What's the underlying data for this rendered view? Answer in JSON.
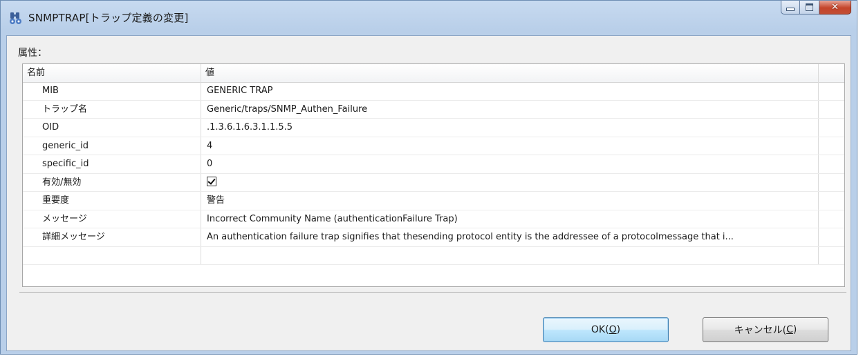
{
  "window": {
    "title": "SNMPTRAP[トラップ定義の変更]",
    "app_icon": "snmp-trap-icon",
    "caption_buttons": [
      "minimize-icon",
      "maximize-icon",
      "close-icon"
    ]
  },
  "attributes_label": "属性：",
  "table": {
    "headers": {
      "name": "名前",
      "value": "値"
    },
    "rows": [
      {
        "name": "MIB",
        "value": "GENERIC TRAP"
      },
      {
        "name": "トラップ名",
        "value": "Generic/traps/SNMP_Authen_Failure"
      },
      {
        "name": "OID",
        "value": ".1.3.6.1.6.3.1.1.5.5"
      },
      {
        "name": "generic_id",
        "value": "4"
      },
      {
        "name": "specific_id",
        "value": "0"
      },
      {
        "name": "有効/無効",
        "value": "",
        "checked": true
      },
      {
        "name": "重要度",
        "value": "警告"
      },
      {
        "name": "メッセージ",
        "value": "Incorrect Community Name (authenticationFailure Trap)"
      },
      {
        "name": "詳細メッセージ",
        "value": "An authentication failure trap signifies that thesending protocol entity is the addressee of a protocolmessage that i..."
      }
    ]
  },
  "buttons": {
    "ok": {
      "label": "OK(",
      "mnemonic": "O",
      "suffix": ")"
    },
    "cancel": {
      "label": "キャンセル(",
      "mnemonic": "C",
      "suffix": ")"
    }
  },
  "colors": {
    "frame": "#b9cfe9",
    "client_bg": "#f0f0f0",
    "default_button": "#3c7fb1",
    "close_button": "#c4442b"
  }
}
